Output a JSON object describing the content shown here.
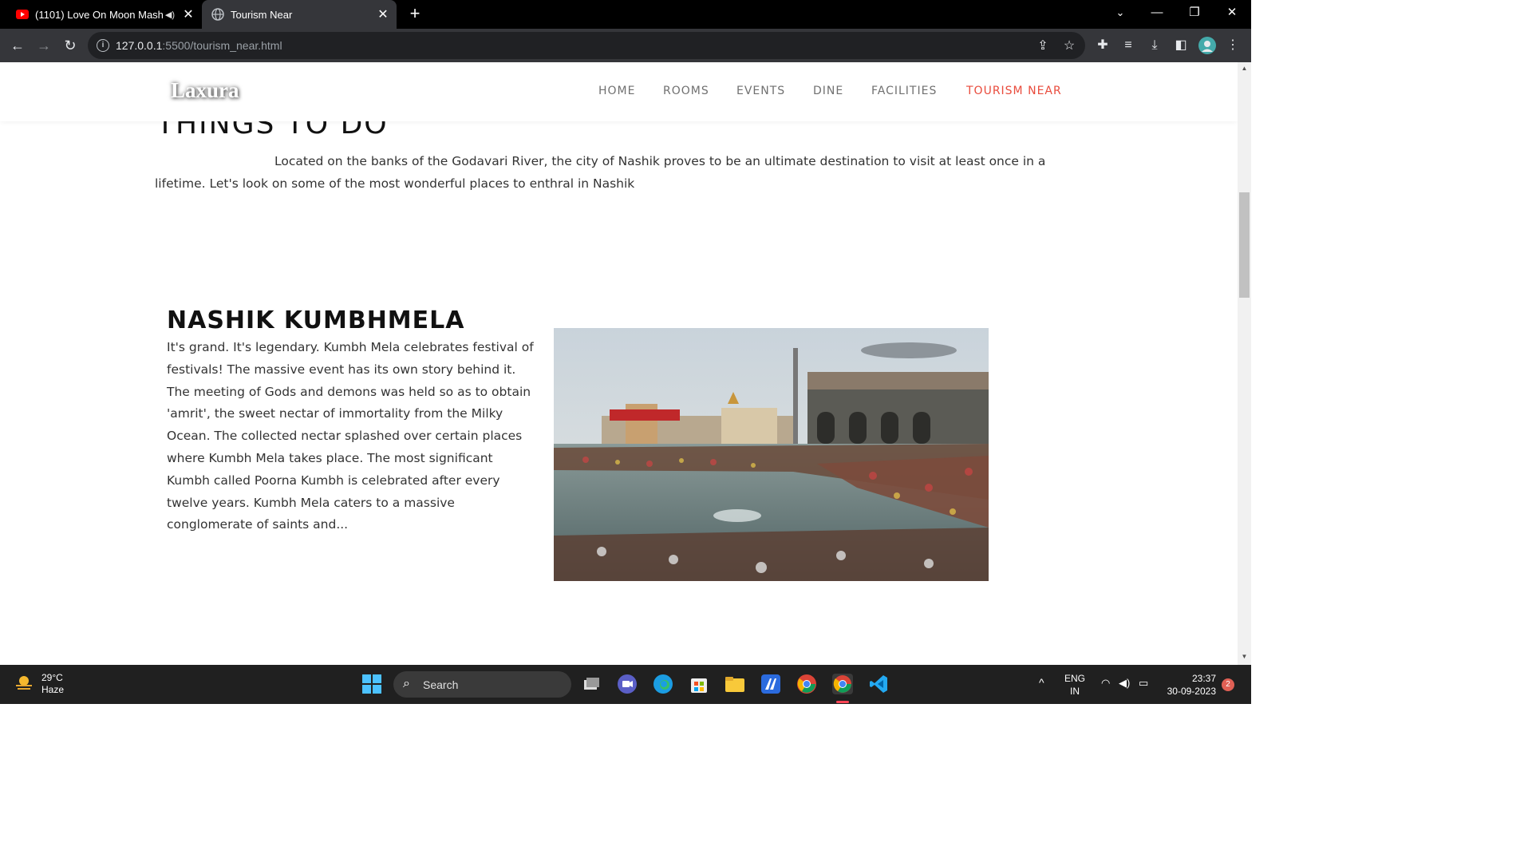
{
  "browser": {
    "tabs": [
      {
        "title": "(1101) Love On Moon Mash",
        "favicon": "youtube-icon",
        "audio": true
      },
      {
        "title": "Tourism Near",
        "favicon": "globe-icon",
        "active": true
      }
    ],
    "url_host": "127.0.0.1",
    "url_rest": ":5500/tourism_near.html"
  },
  "site": {
    "logo": "Laxura",
    "nav": [
      "HOME",
      "ROOMS",
      "EVENTS",
      "DINE",
      "FACILITIES",
      "TOURISM NEAR"
    ],
    "active_nav": "TOURISM NEAR",
    "accent": "#e94b3c"
  },
  "content": {
    "section_heading": "THINGS TO DO",
    "intro": "Located on the banks of the Godavari River, the city of Nashik proves to be an ultimate destination to visit at least once in a lifetime. Let's look on some of the most wonderful places to enthral in Nashik",
    "attraction": {
      "title": "NASHIK KUMBHMELA",
      "description": "It's grand. It's legendary. Kumbh Mela celebrates festival of festivals! The massive event has its own story behind it. The meeting of Gods and demons was held so as to obtain 'amrit', the sweet nectar of immortality from the Milky Ocean. The collected nectar splashed over certain places where Kumbh Mela takes place. The most significant Kumbh called Poorna Kumbh is celebrated after every twelve years. Kumbh Mela caters to a massive conglomerate of saints and..."
    }
  },
  "taskbar": {
    "temperature": "29°C",
    "weather": "Haze",
    "search_label": "Search",
    "lang": "ENG",
    "region": "IN",
    "time": "23:37",
    "date": "30-09-2023",
    "notifications": "2"
  }
}
